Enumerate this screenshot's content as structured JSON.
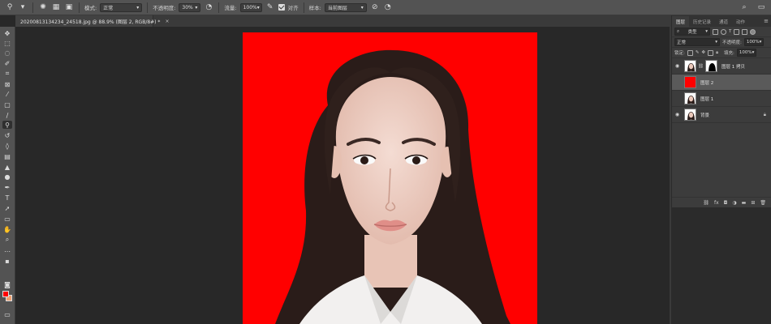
{
  "options_bar": {
    "mode_label": "模式:",
    "mode_value": "正常",
    "opacity_label": "不透明度:",
    "opacity_value": "30%",
    "flow_label": "流量:",
    "flow_value": "100%",
    "aligned_label": "对齐",
    "sample_label": "样本:",
    "sample_value": "当前图层"
  },
  "document": {
    "tab_title": "20200813134234_24518.jpg @ 88.9% (图层 2, RGB/8#) *",
    "close": "×"
  },
  "colors": {
    "foreground": "#ff0000",
    "background": "#f0a070",
    "canvas_bg": "#ff0000"
  },
  "layers_panel": {
    "tabs": [
      "图层",
      "历史记录",
      "通道",
      "动作"
    ],
    "filter_label": "类型",
    "blend_mode": "正常",
    "opacity_label": "不透明度:",
    "opacity_value": "100%",
    "lock_label": "锁定:",
    "fill_label": "填充:",
    "fill_value": "100%",
    "layers": [
      {
        "name": "图层 1 拷贝",
        "visible": true,
        "has_mask": true,
        "selected": false
      },
      {
        "name": "图层 2",
        "visible": false,
        "has_mask": false,
        "selected": true
      },
      {
        "name": "图层 1",
        "visible": false,
        "has_mask": false,
        "selected": false
      },
      {
        "name": "背景",
        "visible": true,
        "has_mask": false,
        "selected": false,
        "locked": true
      }
    ]
  }
}
